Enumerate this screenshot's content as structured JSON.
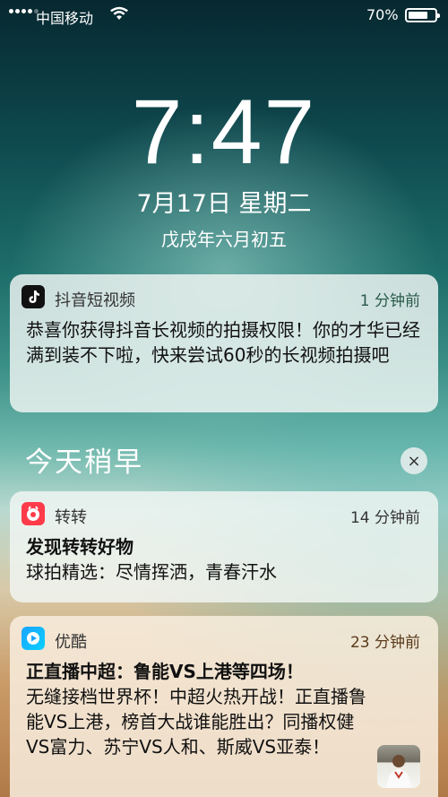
{
  "status_bar": {
    "carrier": "中国移动",
    "battery_percent": "70%",
    "battery_level": 0.7,
    "signal_icon": "signal-icon",
    "wifi_icon": "wifi-icon"
  },
  "lock_screen": {
    "time": "7:47",
    "date": "7月17日 星期二",
    "lunar_date": "戊戌年六月初五"
  },
  "section": {
    "title": "今天稍早",
    "clear_icon": "×"
  },
  "notifications": [
    {
      "app": "抖音短视频",
      "time": "1 分钟前",
      "title": "",
      "message": "恭喜你获得抖音长视频的拍摄权限！你的才华已经满到装不下啦，快来尝试60秒的长视频拍摄吧"
    },
    {
      "app": "转转",
      "time": "14 分钟前",
      "title": "发现转转好物",
      "message": "球拍精选：尽情挥洒，青春汗水"
    },
    {
      "app": "优酷",
      "time": "23 分钟前",
      "title": "正直播中超：鲁能VS上港等四场！",
      "message": "无缝接档世界杯！中超火热开战！正直播鲁能VS上港，榜首大战谁能胜出？同播权健VS富力、苏宁VS人和、斯威VS亚泰！"
    }
  ]
}
